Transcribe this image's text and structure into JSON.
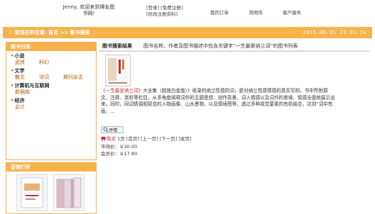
{
  "header": {
    "welcome": "Jenny, 欢迎来到博友图书网!",
    "login": "[登录]",
    "register": "[免费注册]",
    "edit_profile": "[修改注册资料]",
    "nav": [
      "我的订单",
      "购物车",
      "客户服务"
    ]
  },
  "locbar": {
    "location": "☆ 您现在的位置: 首页 >> 图书搜索",
    "datetime": "2015-06-01 23:03:24"
  },
  "sidebar": {
    "title": "图书分类",
    "groups": [
      {
        "title": "小说",
        "items": [
          "武侠",
          "科幻"
        ]
      },
      {
        "title": "文学",
        "items": [
          "散文",
          "诗词",
          "期刊杂志"
        ]
      },
      {
        "title": "计算机与互联网",
        "items": [
          "数据库"
        ]
      },
      {
        "title": "经济",
        "items": [
          "会计"
        ]
      }
    ],
    "promo_title": "促销打折"
  },
  "results": {
    "head_title": "图书搜索结果",
    "head_desc": "图书名称、作者及图书描述中包含关键字“一生最爱纳兰词”的图书列表",
    "book_title": "《一生最爱纳兰词》",
    "book_desc": "大全集（超值白金版）》收录的纳兰性德的词，是对纳兰性德情感的真实写照。书中所附原文、注释、赏析等栏目，从多角度阐释词作的主题思想、创作背景、词人情感以及词作的意境、情感全面地展示出来。同时，同词情调相契合的人物画像、山水景物，以及情境图等，透过多种视觉要素的有机结合，达到“词中有画，...",
    "review_btn": "评情",
    "buy": "购买",
    "pagination": [
      "1页",
      "[首页]",
      "[上一页]",
      "[下一页]",
      "[尾页]"
    ],
    "market_price": "市场价：￥30.00",
    "member_price": "会员价：￥17.80"
  },
  "colors": {
    "accent": "#f6b24b",
    "link_red": "#c4302b"
  }
}
